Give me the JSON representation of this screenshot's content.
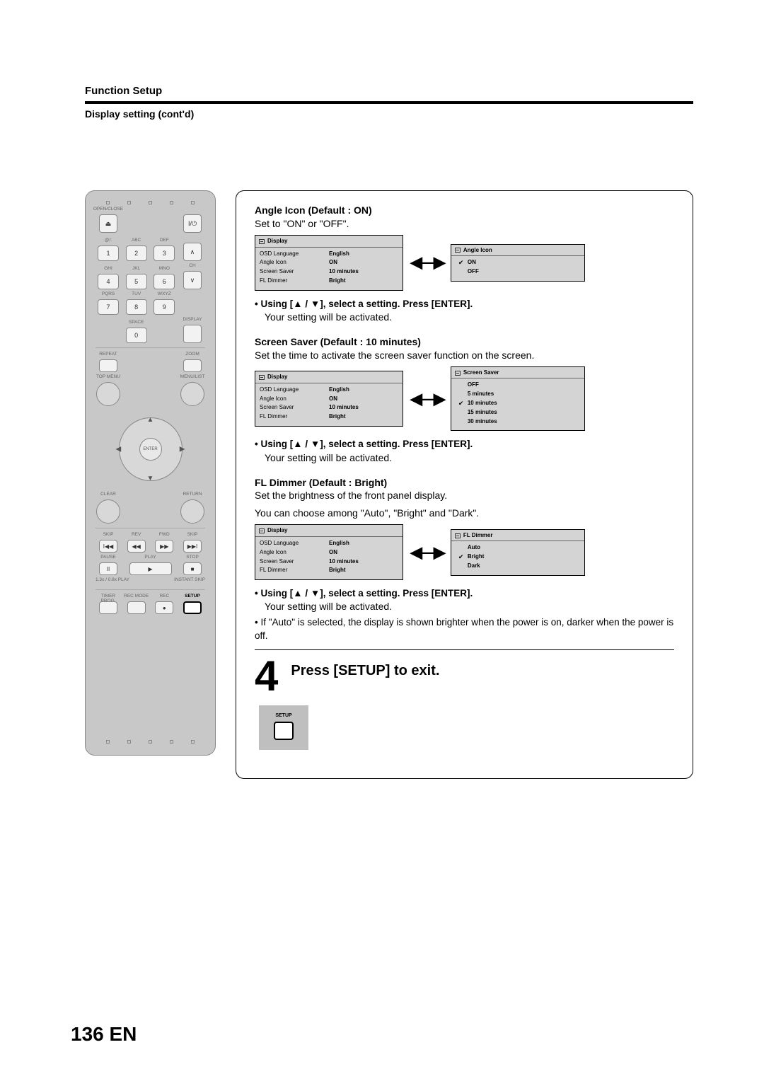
{
  "header": {
    "title": "Function Setup",
    "subtitle": "Display setting (cont'd)"
  },
  "remote": {
    "open_close": "OPEN/CLOSE",
    "power_sym": "I/⏻",
    "abc_labels": [
      "@/:",
      "ABC",
      "DEF"
    ],
    "ghi_labels": [
      "GHI",
      "JKL",
      "MNO"
    ],
    "pqrs_labels": [
      "PQRS",
      "TUV",
      "WXYZ"
    ],
    "space": "SPACE",
    "display": "DISPLAY",
    "ch": "CH",
    "nums": [
      "1",
      "2",
      "3",
      "4",
      "5",
      "6",
      "7",
      "8",
      "9",
      "0"
    ],
    "repeat": "REPEAT",
    "zoom": "ZOOM",
    "topmenu": "TOP MENU",
    "menulist": "MENU/LIST",
    "enter": "ENTER",
    "clear": "CLEAR",
    "return": "RETURN",
    "skip": "SKIP",
    "rev": "REV",
    "fwd": "FWD",
    "pause": "PAUSE",
    "play": "PLAY",
    "stop": "STOP",
    "speed": "1.3x / 0.8x PLAY",
    "instant": "INSTANT SKIP",
    "timer": "TIMER PROG.",
    "recmode": "REC MODE",
    "rec": "REC",
    "setup": "SETUP"
  },
  "sections": {
    "angle": {
      "heading": "Angle Icon (Default : ON)",
      "desc": "Set to \"ON\" or \"OFF\".",
      "left_title": "Display",
      "rows": [
        {
          "k": "OSD Language",
          "v": "English"
        },
        {
          "k": "Angle Icon",
          "v": "ON"
        },
        {
          "k": "Screen Saver",
          "v": "10 minutes"
        },
        {
          "k": "FL Dimmer",
          "v": "Bright"
        }
      ],
      "right_title": "Angle Icon",
      "options": [
        {
          "label": "ON",
          "checked": true
        },
        {
          "label": "OFF",
          "checked": false
        }
      ],
      "instr": "Using [▲ / ▼], select a setting. Press [ENTER].",
      "result": "Your setting will be activated."
    },
    "saver": {
      "heading": "Screen Saver (Default : 10 minutes)",
      "desc": "Set the time to activate the screen saver function on the screen.",
      "left_title": "Display",
      "rows": [
        {
          "k": "OSD Language",
          "v": "English"
        },
        {
          "k": "Angle Icon",
          "v": "ON"
        },
        {
          "k": "Screen Saver",
          "v": "10 minutes"
        },
        {
          "k": "FL Dimmer",
          "v": "Bright"
        }
      ],
      "right_title": "Screen Saver",
      "options": [
        {
          "label": "OFF",
          "checked": false
        },
        {
          "label": "5 minutes",
          "checked": false
        },
        {
          "label": "10 minutes",
          "checked": true
        },
        {
          "label": "15 minutes",
          "checked": false
        },
        {
          "label": "30 minutes",
          "checked": false
        }
      ],
      "instr": "Using [▲ / ▼], select a setting. Press [ENTER].",
      "result": "Your setting will be activated."
    },
    "dimmer": {
      "heading": "FL Dimmer (Default : Bright)",
      "desc1": "Set the brightness of the front panel display.",
      "desc2": "You can choose among \"Auto\", \"Bright\" and \"Dark\".",
      "left_title": "Display",
      "rows": [
        {
          "k": "OSD Language",
          "v": "English"
        },
        {
          "k": "Angle Icon",
          "v": "ON"
        },
        {
          "k": "Screen Saver",
          "v": "10 minutes"
        },
        {
          "k": "FL Dimmer",
          "v": "Bright"
        }
      ],
      "right_title": "FL Dimmer",
      "options": [
        {
          "label": "Auto",
          "checked": false
        },
        {
          "label": "Bright",
          "checked": true
        },
        {
          "label": "Dark",
          "checked": false
        }
      ],
      "instr": "Using [▲ / ▼], select a setting. Press [ENTER].",
      "result": "Your setting will be activated.",
      "note": "If \"Auto\" is selected, the display is shown brighter when the power is on, darker when the power is off."
    }
  },
  "step4": {
    "num": "4",
    "text": "Press [SETUP] to exit.",
    "chip": "SETUP"
  },
  "footer": "136  EN"
}
